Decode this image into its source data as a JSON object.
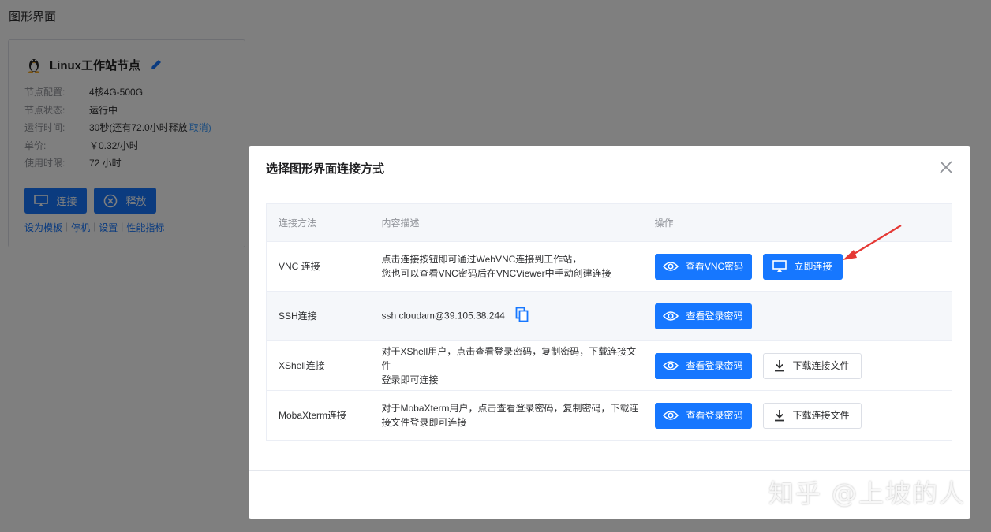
{
  "page": {
    "title": "图形界面"
  },
  "node_card": {
    "name": "Linux工作站节点",
    "rows": [
      {
        "label": "节点配置:",
        "value": "4核4G-500G"
      },
      {
        "label": "节点状态:",
        "value": "运行中"
      },
      {
        "label": "运行时间:",
        "value": "30秒(还有72.0小时释放",
        "link": "取消)"
      },
      {
        "label": "单价:",
        "value": "￥0.32/小时"
      },
      {
        "label": "使用时限:",
        "value": "72 小时"
      }
    ],
    "buttons": {
      "connect": "连接",
      "release": "释放"
    },
    "links": [
      "设为模板",
      "停机",
      "设置",
      "性能指标"
    ]
  },
  "dialog": {
    "title": "选择图形界面连接方式",
    "headers": {
      "method": "连接方法",
      "description": "内容描述",
      "actions": "操作"
    },
    "rows": [
      {
        "method": "VNC 连接",
        "desc_line1": "点击连接按钮即可通过WebVNC连接到工作站，",
        "desc_line2": "您也可以查看VNC密码后在VNCViewer中手动创建连接",
        "primary": "查看VNC密码",
        "secondary": "立即连接"
      },
      {
        "method": "SSH连接",
        "command": "ssh cloudam@39.105.38.244",
        "primary": "查看登录密码"
      },
      {
        "method": "XShell连接",
        "desc_line1": "对于XShell用户，点击查看登录密码，复制密码，下载连接文件",
        "desc_line2": "登录即可连接",
        "primary": "查看登录密码",
        "secondary": "下载连接文件"
      },
      {
        "method": "MobaXterm连接",
        "desc_line1": "对于MobaXterm用户，点击查看登录密码，复制密码，下载连",
        "desc_line2": "接文件登录即可连接",
        "primary": "查看登录密码",
        "secondary": "下载连接文件"
      }
    ]
  },
  "watermark": "知乎 @上坡的人",
  "colors": {
    "primary": "#1677ff",
    "overlay": "rgba(0,0,0,0.5)",
    "arrow": "#e53935"
  },
  "icons": [
    "linux-penguin-icon",
    "edit-pencil-icon",
    "monitor-icon",
    "close-circle-icon",
    "eye-icon",
    "copy-icon",
    "download-icon",
    "close-icon"
  ]
}
